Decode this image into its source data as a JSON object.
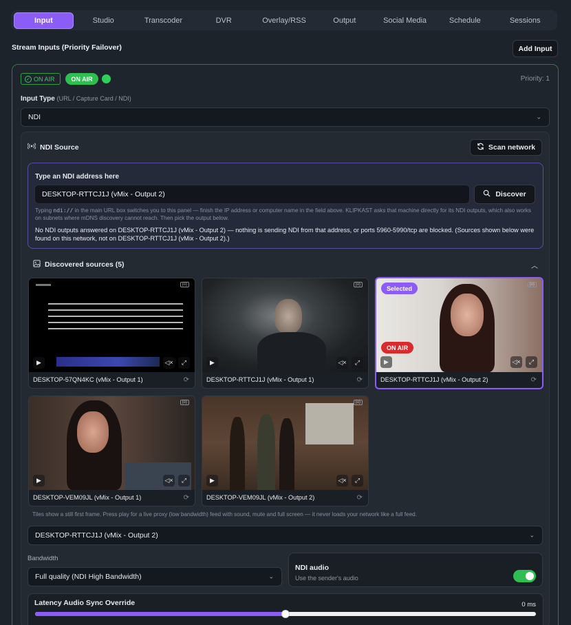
{
  "tabs": [
    {
      "label": "Input",
      "active": true
    },
    {
      "label": "Studio"
    },
    {
      "label": "Transcoder"
    },
    {
      "label": "DVR"
    },
    {
      "label": "Overlay/RSS"
    },
    {
      "label": "Output"
    },
    {
      "label": "Social Media"
    },
    {
      "label": "Schedule"
    },
    {
      "label": "Sessions"
    }
  ],
  "section": {
    "title": "Stream Inputs (Priority Failover)",
    "add_label": "Add Input"
  },
  "card": {
    "status_outline": "ON AIR",
    "status_pill": "ON AIR",
    "priority": "Priority: 1",
    "input_type_label": "Input Type",
    "input_type_hint": "(URL / Capture Card / NDI)",
    "input_type_value": "NDI"
  },
  "ndi": {
    "title": "NDI Source",
    "scan_label": "Scan network",
    "addr_title": "Type an NDI address here",
    "addr_value": "DESKTOP-RTTCJ1J (vMix - Output 2)",
    "discover_label": "Discover",
    "hint_pre": "Typing",
    "hint_code": "ndi://",
    "hint_post": "in the main URL box switches you to this panel — finish the IP address or computer name in the field above. KLIPKAST asks that machine directly for its NDI outputs, which also works on subnets where mDNS discovery cannot reach. Then pick the output below.",
    "warning": "No NDI outputs answered on DESKTOP-RTTCJ1J (vMix - Output 2) — nothing is sending NDI from that address, or ports 5960-5990/tcp are blocked. (Sources shown below were found on this network, not on DESKTOP-RTTCJ1J (vMix - Output 2).)",
    "discovered_title": "Discovered sources (5)",
    "sources": [
      {
        "name": "DESKTOP-57QN4KC (vMix - Output 1)"
      },
      {
        "name": "DESKTOP-RTTCJ1J (vMix - Output 1)"
      },
      {
        "name": "DESKTOP-RTTCJ1J (vMix - Output 2)",
        "selected": true,
        "selected_tag": "Selected",
        "onair_tag": "ON AIR"
      },
      {
        "name": "DESKTOP-VEM09JL (vMix - Output 1)"
      },
      {
        "name": "DESKTOP-VEM09JL (vMix - Output 2)"
      }
    ],
    "tiles_note": "Tiles show a still first frame. Press play for a live proxy (low bandwidth) feed with sound, mute and full screen — it never loads your network like a full feed.",
    "selected_source": "DESKTOP-RTTCJ1J (vMix - Output 2)",
    "bandwidth_label": "Bandwidth",
    "bandwidth_value": "Full quality (NDI High Bandwidth)",
    "audio_title": "NDI audio",
    "audio_sub": "Use the sender's audio",
    "audio_enabled": true,
    "latency_title": "Latency Audio Sync Override",
    "latency_value": "0 ms",
    "latency_fraction": 0.5
  },
  "colors": {
    "accent": "#8b5cf6",
    "onair": "#2fbe52",
    "live_red": "#d92b2b"
  }
}
